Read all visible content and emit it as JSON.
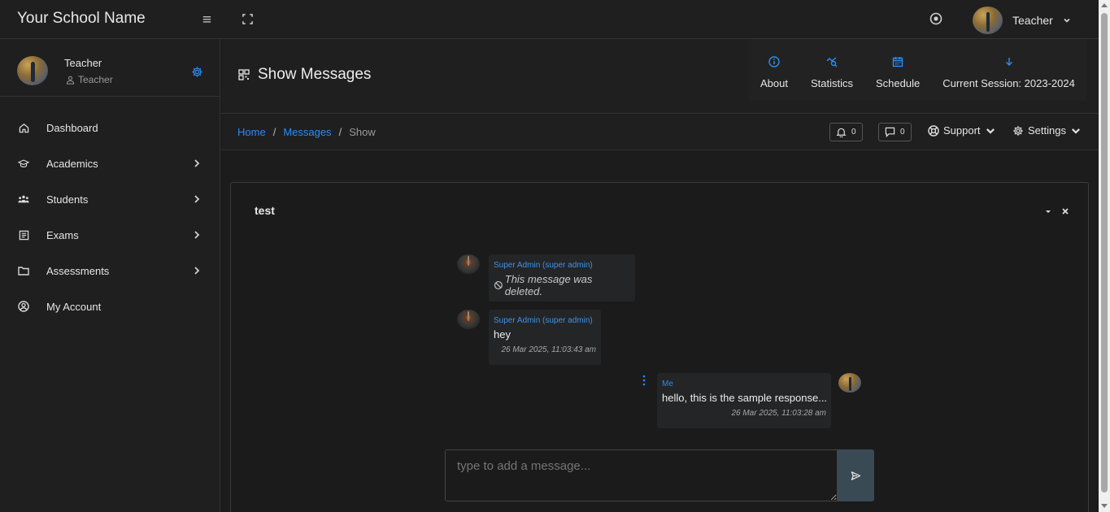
{
  "topbar": {
    "brand": "Your School Name",
    "user_name": "Teacher",
    "icons": [
      "hamburger-icon",
      "fullscreen-icon",
      "theme-toggle-icon",
      "chevron-down-icon"
    ]
  },
  "sidebar": {
    "user_name": "Teacher",
    "user_role": "Teacher",
    "items": [
      {
        "label": "Dashboard",
        "icon": "home-icon",
        "has_children": false
      },
      {
        "label": "Academics",
        "icon": "graduation-cap-icon",
        "has_children": true
      },
      {
        "label": "Students",
        "icon": "users-icon",
        "has_children": true
      },
      {
        "label": "Exams",
        "icon": "list-icon",
        "has_children": true
      },
      {
        "label": "Assessments",
        "icon": "folder-icon",
        "has_children": true
      },
      {
        "label": "My Account",
        "icon": "user-circle-icon",
        "has_children": false
      }
    ]
  },
  "header": {
    "title": "Show Messages",
    "shortcuts": [
      {
        "label": "About",
        "icon": "info-icon"
      },
      {
        "label": "Statistics",
        "icon": "chart-icon"
      },
      {
        "label": "Schedule",
        "icon": "calendar-icon"
      },
      {
        "label": "Current Session: 2023-2024",
        "icon": "arrow-down-icon"
      }
    ]
  },
  "breadcrumb": {
    "home": "Home",
    "messages": "Messages",
    "current": "Show",
    "sep": "/"
  },
  "toolbar": {
    "notifications_count": "0",
    "messages_count": "0",
    "support_label": "Support",
    "settings_label": "Settings"
  },
  "thread": {
    "title": "test",
    "messages": [
      {
        "sender": "Super Admin (super admin)",
        "deleted_text": "This message was deleted.",
        "text": "",
        "time": "",
        "mine": false
      },
      {
        "sender": "Super Admin (super admin)",
        "text": "hey",
        "time": "26 Mar 2025, 11:03:43 am",
        "mine": false
      },
      {
        "sender": "Me",
        "text": "hello, this is the sample response...",
        "time": "26 Mar 2025, 11:03:28 am",
        "mine": true
      }
    ],
    "composer_placeholder": "type to add a message..."
  },
  "colors": {
    "accent": "#2d8cf0",
    "background": "#1c1c1c",
    "panel": "#1f1f1f",
    "bubble": "#242526"
  }
}
